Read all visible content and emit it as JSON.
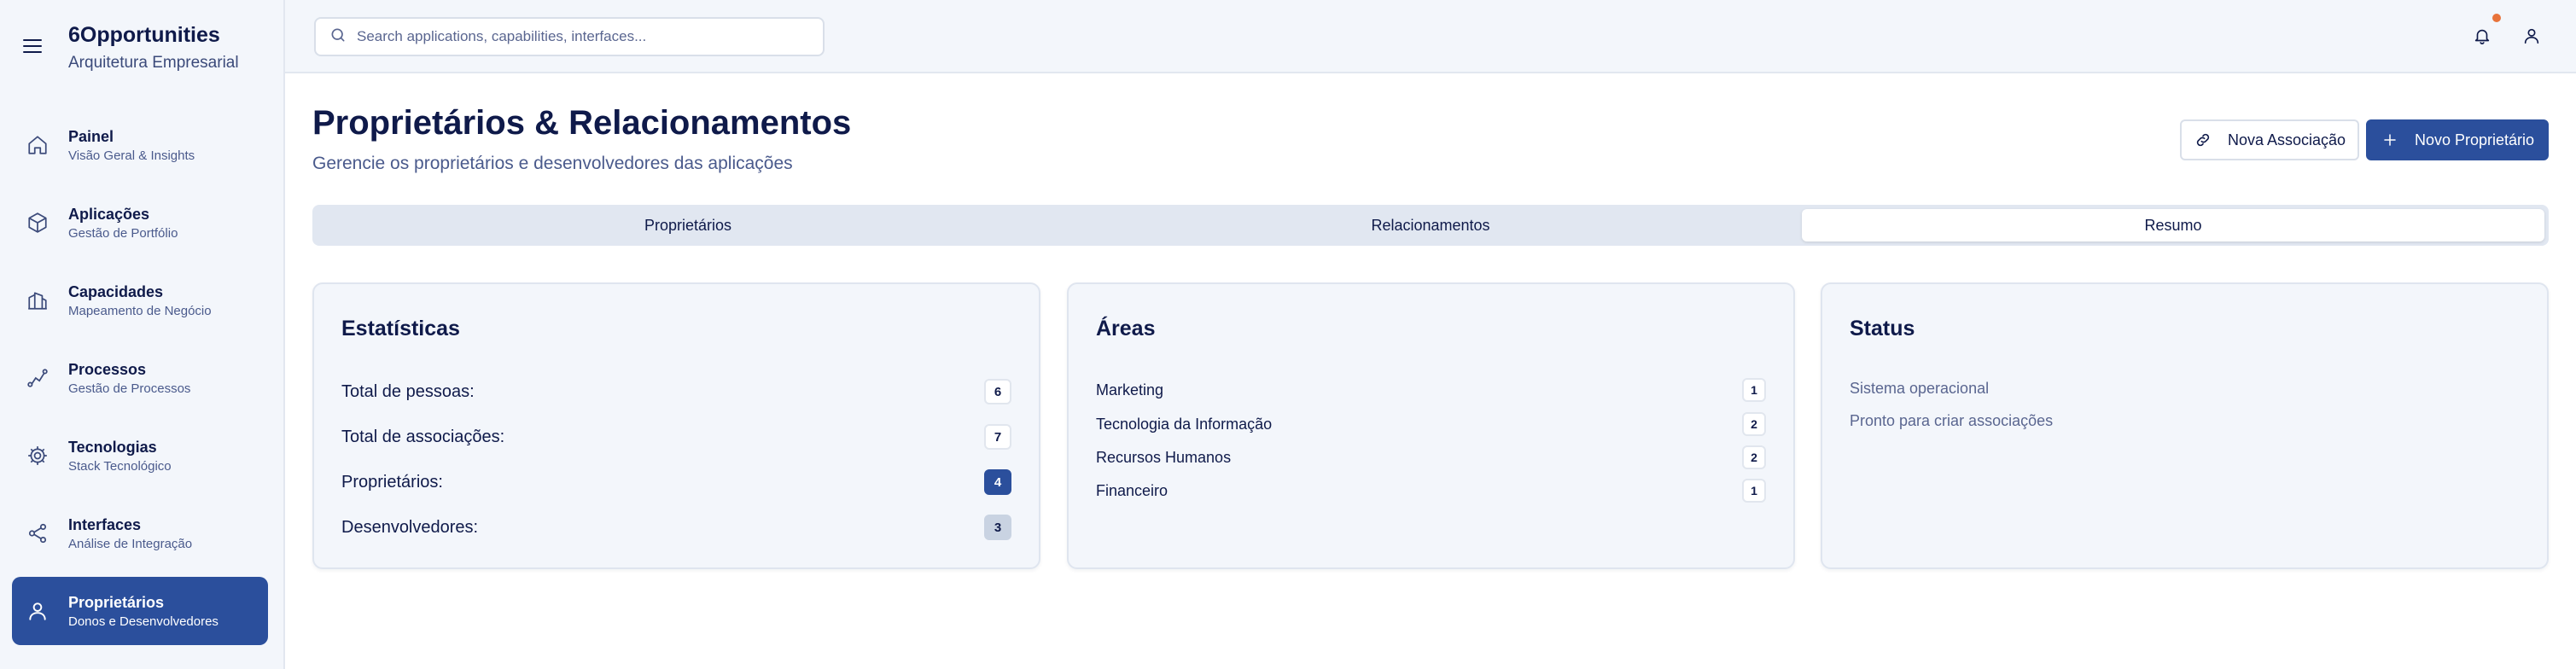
{
  "brand": {
    "title": "6Opportunities",
    "subtitle": "Arquitetura Empresarial"
  },
  "sidebar": {
    "items": [
      {
        "label": "Painel",
        "sub": "Visão Geral & Insights",
        "icon": "home-icon"
      },
      {
        "label": "Aplicações",
        "sub": "Gestão de Portfólio",
        "icon": "cube-icon"
      },
      {
        "label": "Capacidades",
        "sub": "Mapeamento de Negócio",
        "icon": "building-icon"
      },
      {
        "label": "Processos",
        "sub": "Gestão de Processos",
        "icon": "route-icon"
      },
      {
        "label": "Tecnologias",
        "sub": "Stack Tecnológico",
        "icon": "gear-icon"
      },
      {
        "label": "Interfaces",
        "sub": "Análise de Integração",
        "icon": "share-icon"
      },
      {
        "label": "Proprietários",
        "sub": "Donos e Desenvolvedores",
        "icon": "user-icon",
        "active": true
      }
    ]
  },
  "topbar": {
    "search_placeholder": "Search applications, capabilities, interfaces..."
  },
  "header": {
    "title": "Proprietários & Relacionamentos",
    "subtitle": "Gerencie os proprietários e desenvolvedores das aplicações",
    "btn_association": "Nova Associação",
    "btn_owner": "Novo Proprietário"
  },
  "tabs": [
    {
      "label": "Proprietários"
    },
    {
      "label": "Relacionamentos"
    },
    {
      "label": "Resumo",
      "active": true
    }
  ],
  "stats": {
    "title": "Estatísticas",
    "rows": [
      {
        "label": "Total de pessoas:",
        "value": "6"
      },
      {
        "label": "Total de associações:",
        "value": "7"
      },
      {
        "label": "Proprietários:",
        "value": "4"
      },
      {
        "label": "Desenvolvedores:",
        "value": "3"
      }
    ]
  },
  "areas": {
    "title": "Áreas",
    "rows": [
      {
        "label": "Marketing",
        "value": "1"
      },
      {
        "label": "Tecnologia da Informação",
        "value": "2"
      },
      {
        "label": "Recursos Humanos",
        "value": "2"
      },
      {
        "label": "Financeiro",
        "value": "1"
      }
    ]
  },
  "status": {
    "title": "Status",
    "lines": [
      "Sistema operacional",
      "Pronto para criar associações"
    ]
  },
  "colors": {
    "primary": "#2b4f9c",
    "notification": "#e8733a",
    "text": "#0f1a4a",
    "panel": "#f3f6fb"
  }
}
